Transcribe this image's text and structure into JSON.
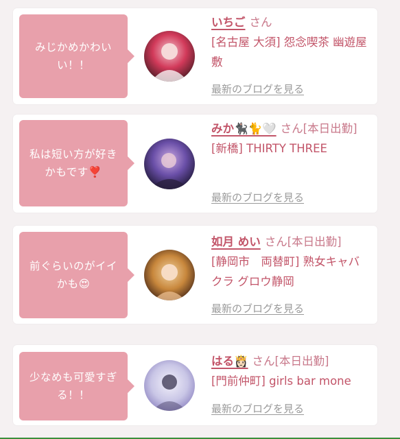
{
  "cards": [
    {
      "bubble_text": "みじかめかわいい！！",
      "name": "いちご",
      "san_suffix": "さん",
      "shop": "[名古屋 大須] 怨念喫茶 幽遊屋敷",
      "blog_link": "最新のブログを見る",
      "avatar_colors": [
        "#5a1f2a",
        "#d23a5a",
        "#f2c2cc"
      ]
    },
    {
      "bubble_text": "私は短い方が好きかもです❣️",
      "name": "みか🐈‍⬛🐈🤍",
      "san_suffix": "さん[本日出勤]",
      "shop": "[新橋] THIRTY THREE",
      "blog_link": "最新のブログを見る",
      "avatar_colors": [
        "#1b1530",
        "#6a4fa8",
        "#c9a8e0"
      ]
    },
    {
      "bubble_text": "前ぐらいのがイイかも😍",
      "name": "如月 めい",
      "san_suffix": "さん[本日出勤]",
      "shop": "[静岡市　両替町] 熟女キャバクラ グロウ静岡",
      "blog_link": "最新のブログを見る",
      "avatar_colors": [
        "#4a2a18",
        "#c8873c",
        "#f0d2a0"
      ]
    },
    {
      "bubble_text": "少なめも可愛すぎる！！",
      "name": "はる👸🏻",
      "san_suffix": "さん[本日出勤]",
      "shop": "[門前仲町] girls bar mone",
      "blog_link": "最新のブログを見る",
      "avatar_colors": [
        "#c9c6e6",
        "#8f86c2",
        "#f2f0fa"
      ]
    }
  ]
}
